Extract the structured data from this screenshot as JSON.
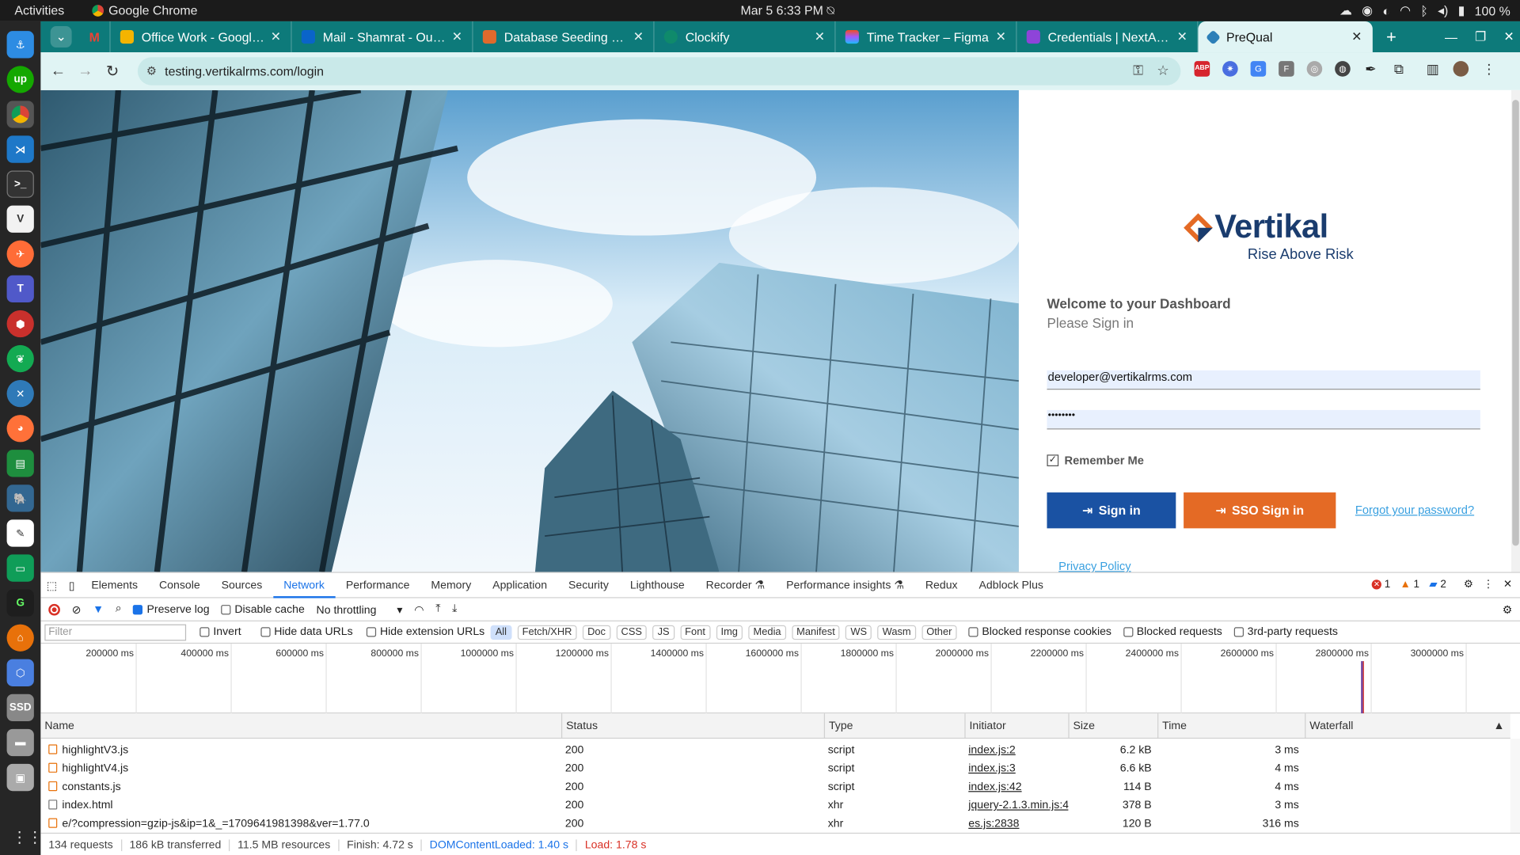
{
  "system": {
    "activities": "Activities",
    "app_name": "Google Chrome",
    "clock": "Mar 5   6:33 PM",
    "battery": "100 %"
  },
  "browser": {
    "tabs": [
      {
        "label": "Office Work - Google D",
        "color": "#f4b400"
      },
      {
        "label": "Mail - Shamrat - Outloo",
        "color": "#0a64c9"
      },
      {
        "label": "Database Seeding — C",
        "color": "#e06a2c"
      },
      {
        "label": "Clockify",
        "color": "#0f8a6b"
      },
      {
        "label": "Time Tracker – Figma",
        "color": "#a259ff"
      },
      {
        "label": "Credentials | NextAuth",
        "color": "#8e44d9"
      },
      {
        "label": "PreQual",
        "color": "#2c7fb8"
      }
    ],
    "url": "testing.vertikalrms.com/login",
    "new_tab": "+"
  },
  "login": {
    "brand": "Vertikal",
    "tagline": "Rise Above Risk",
    "welcome": "Welcome to your Dashboard",
    "please": "Please Sign in",
    "email_value": "developer@vertikalrms.com",
    "password_value": "••••••••",
    "remember_label": "Remember Me",
    "signin_label": "Sign in",
    "sso_label": "SSO Sign in",
    "forgot_label": "Forgot your password?",
    "privacy_label": "Privacy Policy",
    "colors": {
      "primary": "#1a52a3",
      "sso": "#e46a25",
      "link": "#39a0e0",
      "brand": "#1a3c6e"
    }
  },
  "devtools": {
    "tabs": [
      "Elements",
      "Console",
      "Sources",
      "Network",
      "Performance",
      "Memory",
      "Application",
      "Security",
      "Lighthouse",
      "Recorder",
      "Performance insights",
      "Redux",
      "Adblock Plus"
    ],
    "active_tab": "Network",
    "errors": "1",
    "warnings": "1",
    "messages": "2",
    "preserve_log": "Preserve log",
    "disable_cache": "Disable cache",
    "throttling": "No throttling",
    "filter_placeholder": "Filter",
    "invert": "Invert",
    "hide_data_urls": "Hide data URLs",
    "hide_ext_urls": "Hide extension URLs",
    "type_chips": [
      "All",
      "Fetch/XHR",
      "Doc",
      "CSS",
      "JS",
      "Font",
      "Img",
      "Media",
      "Manifest",
      "WS",
      "Wasm",
      "Other"
    ],
    "blocked_cookies": "Blocked response cookies",
    "blocked_requests": "Blocked requests",
    "third_party": "3rd-party requests",
    "overview_ticks": [
      "200000 ms",
      "400000 ms",
      "600000 ms",
      "800000 ms",
      "1000000 ms",
      "1200000 ms",
      "1400000 ms",
      "1600000 ms",
      "1800000 ms",
      "2000000 ms",
      "2200000 ms",
      "2400000 ms",
      "2600000 ms",
      "2800000 ms",
      "3000000 ms"
    ],
    "columns": {
      "name": "Name",
      "status": "Status",
      "type": "Type",
      "initiator": "Initiator",
      "size": "Size",
      "time": "Time",
      "waterfall": "Waterfall"
    },
    "rows": [
      {
        "name": "highlightV3.js",
        "status": "200",
        "type": "script",
        "initiator": "index.js:2",
        "size": "6.2 kB",
        "time": "3 ms",
        "kind": "script"
      },
      {
        "name": "highlightV4.js",
        "status": "200",
        "type": "script",
        "initiator": "index.js:3",
        "size": "6.6 kB",
        "time": "4 ms",
        "kind": "script"
      },
      {
        "name": "constants.js",
        "status": "200",
        "type": "script",
        "initiator": "index.js:42",
        "size": "114 B",
        "time": "4 ms",
        "kind": "script"
      },
      {
        "name": "index.html",
        "status": "200",
        "type": "xhr",
        "initiator": "jquery-2.1.3.min.js:4",
        "size": "378 B",
        "time": "3 ms",
        "kind": "doc"
      },
      {
        "name": "e/?compression=gzip-js&ip=1&_=1709641981398&ver=1.77.0",
        "status": "200",
        "type": "xhr",
        "initiator": "es.js:2838",
        "size": "120 B",
        "time": "316 ms",
        "kind": "script"
      }
    ],
    "summary": {
      "requests": "134 requests",
      "transferred": "186 kB transferred",
      "resources": "11.5 MB resources",
      "finish": "Finish: 4.72 s",
      "dcl": "DOMContentLoaded: 1.40 s",
      "load": "Load: 1.78 s"
    }
  }
}
